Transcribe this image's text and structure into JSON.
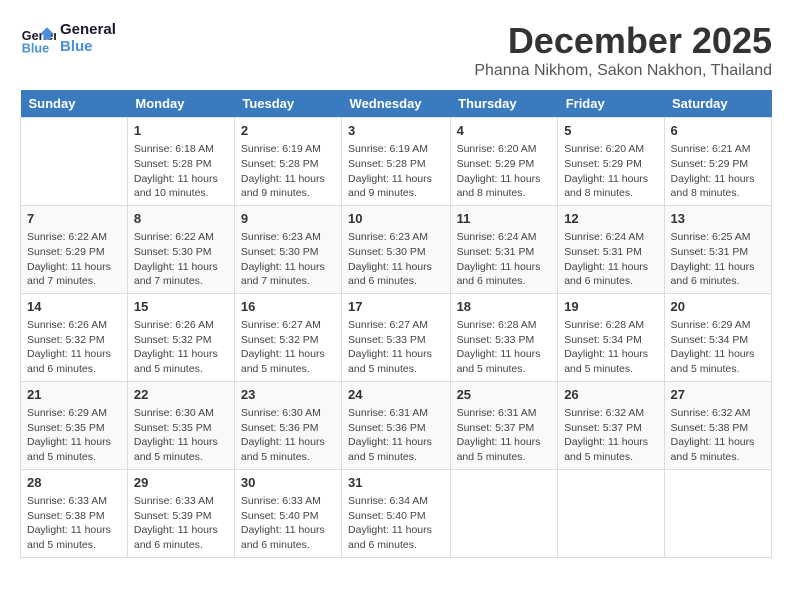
{
  "logo": {
    "line1": "General",
    "line2": "Blue"
  },
  "title": "December 2025",
  "location": "Phanna Nikhom, Sakon Nakhon, Thailand",
  "weekdays": [
    "Sunday",
    "Monday",
    "Tuesday",
    "Wednesday",
    "Thursday",
    "Friday",
    "Saturday"
  ],
  "rows": [
    [
      {
        "day": "",
        "sunrise": "",
        "sunset": "",
        "daylight": ""
      },
      {
        "day": "1",
        "sunrise": "Sunrise: 6:18 AM",
        "sunset": "Sunset: 5:28 PM",
        "daylight": "Daylight: 11 hours and 10 minutes."
      },
      {
        "day": "2",
        "sunrise": "Sunrise: 6:19 AM",
        "sunset": "Sunset: 5:28 PM",
        "daylight": "Daylight: 11 hours and 9 minutes."
      },
      {
        "day": "3",
        "sunrise": "Sunrise: 6:19 AM",
        "sunset": "Sunset: 5:28 PM",
        "daylight": "Daylight: 11 hours and 9 minutes."
      },
      {
        "day": "4",
        "sunrise": "Sunrise: 6:20 AM",
        "sunset": "Sunset: 5:29 PM",
        "daylight": "Daylight: 11 hours and 8 minutes."
      },
      {
        "day": "5",
        "sunrise": "Sunrise: 6:20 AM",
        "sunset": "Sunset: 5:29 PM",
        "daylight": "Daylight: 11 hours and 8 minutes."
      },
      {
        "day": "6",
        "sunrise": "Sunrise: 6:21 AM",
        "sunset": "Sunset: 5:29 PM",
        "daylight": "Daylight: 11 hours and 8 minutes."
      }
    ],
    [
      {
        "day": "7",
        "sunrise": "Sunrise: 6:22 AM",
        "sunset": "Sunset: 5:29 PM",
        "daylight": "Daylight: 11 hours and 7 minutes."
      },
      {
        "day": "8",
        "sunrise": "Sunrise: 6:22 AM",
        "sunset": "Sunset: 5:30 PM",
        "daylight": "Daylight: 11 hours and 7 minutes."
      },
      {
        "day": "9",
        "sunrise": "Sunrise: 6:23 AM",
        "sunset": "Sunset: 5:30 PM",
        "daylight": "Daylight: 11 hours and 7 minutes."
      },
      {
        "day": "10",
        "sunrise": "Sunrise: 6:23 AM",
        "sunset": "Sunset: 5:30 PM",
        "daylight": "Daylight: 11 hours and 6 minutes."
      },
      {
        "day": "11",
        "sunrise": "Sunrise: 6:24 AM",
        "sunset": "Sunset: 5:31 PM",
        "daylight": "Daylight: 11 hours and 6 minutes."
      },
      {
        "day": "12",
        "sunrise": "Sunrise: 6:24 AM",
        "sunset": "Sunset: 5:31 PM",
        "daylight": "Daylight: 11 hours and 6 minutes."
      },
      {
        "day": "13",
        "sunrise": "Sunrise: 6:25 AM",
        "sunset": "Sunset: 5:31 PM",
        "daylight": "Daylight: 11 hours and 6 minutes."
      }
    ],
    [
      {
        "day": "14",
        "sunrise": "Sunrise: 6:26 AM",
        "sunset": "Sunset: 5:32 PM",
        "daylight": "Daylight: 11 hours and 6 minutes."
      },
      {
        "day": "15",
        "sunrise": "Sunrise: 6:26 AM",
        "sunset": "Sunset: 5:32 PM",
        "daylight": "Daylight: 11 hours and 5 minutes."
      },
      {
        "day": "16",
        "sunrise": "Sunrise: 6:27 AM",
        "sunset": "Sunset: 5:32 PM",
        "daylight": "Daylight: 11 hours and 5 minutes."
      },
      {
        "day": "17",
        "sunrise": "Sunrise: 6:27 AM",
        "sunset": "Sunset: 5:33 PM",
        "daylight": "Daylight: 11 hours and 5 minutes."
      },
      {
        "day": "18",
        "sunrise": "Sunrise: 6:28 AM",
        "sunset": "Sunset: 5:33 PM",
        "daylight": "Daylight: 11 hours and 5 minutes."
      },
      {
        "day": "19",
        "sunrise": "Sunrise: 6:28 AM",
        "sunset": "Sunset: 5:34 PM",
        "daylight": "Daylight: 11 hours and 5 minutes."
      },
      {
        "day": "20",
        "sunrise": "Sunrise: 6:29 AM",
        "sunset": "Sunset: 5:34 PM",
        "daylight": "Daylight: 11 hours and 5 minutes."
      }
    ],
    [
      {
        "day": "21",
        "sunrise": "Sunrise: 6:29 AM",
        "sunset": "Sunset: 5:35 PM",
        "daylight": "Daylight: 11 hours and 5 minutes."
      },
      {
        "day": "22",
        "sunrise": "Sunrise: 6:30 AM",
        "sunset": "Sunset: 5:35 PM",
        "daylight": "Daylight: 11 hours and 5 minutes."
      },
      {
        "day": "23",
        "sunrise": "Sunrise: 6:30 AM",
        "sunset": "Sunset: 5:36 PM",
        "daylight": "Daylight: 11 hours and 5 minutes."
      },
      {
        "day": "24",
        "sunrise": "Sunrise: 6:31 AM",
        "sunset": "Sunset: 5:36 PM",
        "daylight": "Daylight: 11 hours and 5 minutes."
      },
      {
        "day": "25",
        "sunrise": "Sunrise: 6:31 AM",
        "sunset": "Sunset: 5:37 PM",
        "daylight": "Daylight: 11 hours and 5 minutes."
      },
      {
        "day": "26",
        "sunrise": "Sunrise: 6:32 AM",
        "sunset": "Sunset: 5:37 PM",
        "daylight": "Daylight: 11 hours and 5 minutes."
      },
      {
        "day": "27",
        "sunrise": "Sunrise: 6:32 AM",
        "sunset": "Sunset: 5:38 PM",
        "daylight": "Daylight: 11 hours and 5 minutes."
      }
    ],
    [
      {
        "day": "28",
        "sunrise": "Sunrise: 6:33 AM",
        "sunset": "Sunset: 5:38 PM",
        "daylight": "Daylight: 11 hours and 5 minutes."
      },
      {
        "day": "29",
        "sunrise": "Sunrise: 6:33 AM",
        "sunset": "Sunset: 5:39 PM",
        "daylight": "Daylight: 11 hours and 6 minutes."
      },
      {
        "day": "30",
        "sunrise": "Sunrise: 6:33 AM",
        "sunset": "Sunset: 5:40 PM",
        "daylight": "Daylight: 11 hours and 6 minutes."
      },
      {
        "day": "31",
        "sunrise": "Sunrise: 6:34 AM",
        "sunset": "Sunset: 5:40 PM",
        "daylight": "Daylight: 11 hours and 6 minutes."
      },
      {
        "day": "",
        "sunrise": "",
        "sunset": "",
        "daylight": ""
      },
      {
        "day": "",
        "sunrise": "",
        "sunset": "",
        "daylight": ""
      },
      {
        "day": "",
        "sunrise": "",
        "sunset": "",
        "daylight": ""
      }
    ]
  ]
}
